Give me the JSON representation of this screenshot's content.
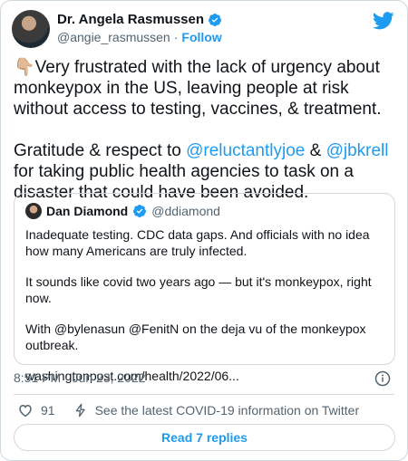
{
  "author": {
    "name": "Dr. Angela Rasmussen",
    "handle": "@angie_rasmussen",
    "separator": "·",
    "follow_label": "Follow"
  },
  "tweet": {
    "emoji": "👇🏼",
    "line1": "Very frustrated with the lack of urgency about monkeypox in the US, leaving people at risk without access to testing, vaccines, & treatment.",
    "p2_a": "Gratitude & respect to ",
    "mention1": "@reluctantlyjoe",
    "p2_b": " & ",
    "mention2": "@jbkrell",
    "p2_c": " for taking public health agencies to task on a disaster that could have been avoided."
  },
  "quote": {
    "name": "Dan Diamond",
    "handle": "@ddiamond",
    "para1": "Inadequate testing. CDC data gaps. And officials with no idea how many Americans are truly infected.",
    "para2": "It sounds like covid two years ago — but it's monkeypox, right now.",
    "para3": "With @bylenasun @FenitN on the deja vu of the monkeypox outbreak.",
    "link": "washingtonpost.com/health/2022/06..."
  },
  "meta": {
    "timestamp": "8:51 PM · Jun 23, 2022"
  },
  "actions": {
    "like_count": "91",
    "covid_info": "See the latest COVID-19 information on Twitter"
  },
  "read_replies_label": "Read 7 replies",
  "colors": {
    "accent": "#1d9bf0",
    "text": "#0f1419",
    "muted": "#536471",
    "border": "#cfd9de"
  }
}
